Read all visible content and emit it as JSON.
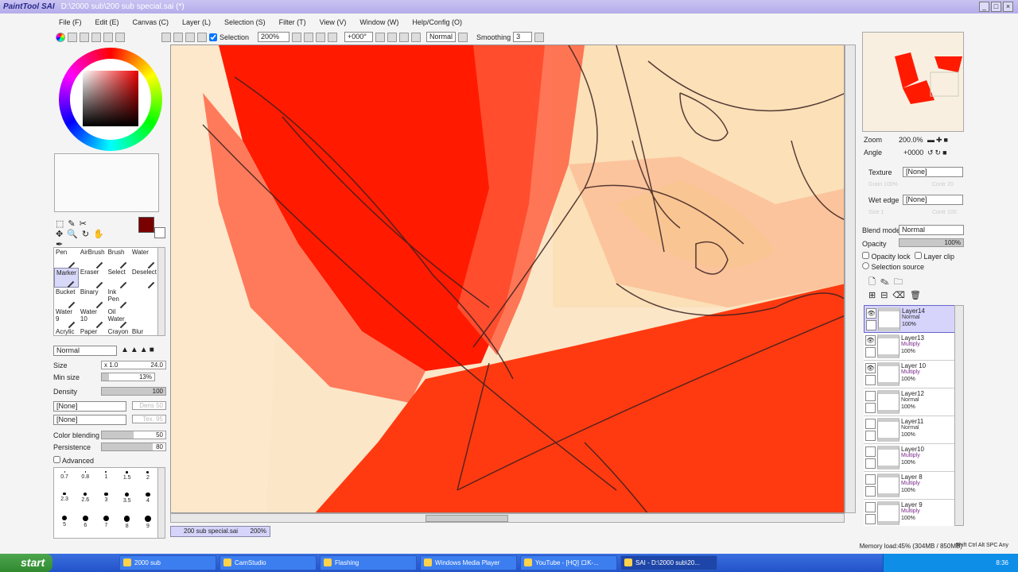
{
  "app": {
    "logo": "PaintTool SAI",
    "title": "D:\\2000 sub\\200 sub special.sai (*)"
  },
  "menu": [
    "File (F)",
    "Edit (E)",
    "Canvas (C)",
    "Layer (L)",
    "Selection (S)",
    "Filter (T)",
    "View (V)",
    "Window (W)",
    "Help/Config (O)"
  ],
  "toolbar": {
    "selection_label": "Selection",
    "selection_checked": true,
    "zoom": "200%",
    "angle": "+000°",
    "mode": "Normal",
    "smoothing_label": "Smoothing",
    "smoothing": "3"
  },
  "tools": [
    "Pen",
    "AirBrush",
    "Brush",
    "Water",
    "Marker",
    "Eraser",
    "Select",
    "Deselect",
    "Bucket",
    "Binary",
    "Ink Pen",
    "",
    "Water 9",
    "Water 10",
    "Oil Water",
    "",
    "Acrylic",
    "Paper",
    "Crayon",
    "Blur"
  ],
  "selected_tool": "Marker",
  "brush": {
    "blend_mode": "Normal",
    "size_label": "Size",
    "size_mult": "x 1.0",
    "size": "24.0",
    "min_size_label": "Min size",
    "min_size": "13%",
    "min_size_pct": 13,
    "density_label": "Density",
    "density": "100",
    "texture1": "[None]",
    "texture1_val": "Dens 50",
    "texture2": "[None]",
    "texture2_val": "Tex. 95",
    "color_blending_label": "Color blending",
    "color_blending": "50",
    "persistence_label": "Persistence",
    "persistence": "80",
    "advanced_label": "Advanced"
  },
  "brush_sizes": [
    "0.7",
    "0.8",
    "1",
    "1.5",
    "2",
    "2.3",
    "2.6",
    "3",
    "3.5",
    "4",
    "5",
    "6",
    "7",
    "8",
    "9"
  ],
  "primary_color": "#7a0000",
  "navigator": {
    "zoom_label": "Zoom",
    "zoom": "200.0%",
    "angle_label": "Angle",
    "angle": "+0000"
  },
  "layer_props": {
    "texture_label": "Texture",
    "texture": "[None]",
    "grain": "Grain 100%",
    "contrast": "Contr 20",
    "wet_edge_label": "Wet edge",
    "wet_edge": "[None]",
    "we_size": "Size 1",
    "we_contr": "Contr 100",
    "blend_label": "Blend mode",
    "blend": "Normal",
    "opacity_label": "Opacity",
    "opacity": "100%",
    "opacity_lock": "Opacity lock",
    "layer_clip": "Layer clip",
    "selection_source": "Selection source"
  },
  "layers": [
    {
      "name": "Layer14",
      "mode": "Normal",
      "opacity": "100%",
      "visible": true,
      "selected": true
    },
    {
      "name": "Layer13",
      "mode": "Multiply",
      "opacity": "100%",
      "visible": true
    },
    {
      "name": "Layer 10",
      "mode": "Multiply",
      "opacity": "100%",
      "visible": true
    },
    {
      "name": "Layer12",
      "mode": "Normal",
      "opacity": "100%",
      "visible": false
    },
    {
      "name": "Layer11",
      "mode": "Normal",
      "opacity": "100%",
      "visible": false
    },
    {
      "name": "Layer10",
      "mode": "Multiply",
      "opacity": "100%",
      "visible": false
    },
    {
      "name": "Layer 8",
      "mode": "Multiply",
      "opacity": "100%",
      "visible": false
    },
    {
      "name": "Layer 9",
      "mode": "Multiply",
      "opacity": "100%",
      "visible": false
    }
  ],
  "doc_tab": {
    "name": "200 sub special.sai",
    "zoom": "200%"
  },
  "status": {
    "memory": "Memory load:45% (304MB / 850MB)",
    "keys": "Shift Ctrl Alt SPC Any"
  },
  "taskbar": {
    "start": "start",
    "tasks": [
      "2000 sub",
      "CamStudio",
      "Flashing",
      "Windows Media Player",
      "YouTube - [HQ] ロK-...",
      "SAI - D:\\2000 sub\\20..."
    ],
    "clock": "8:36"
  }
}
